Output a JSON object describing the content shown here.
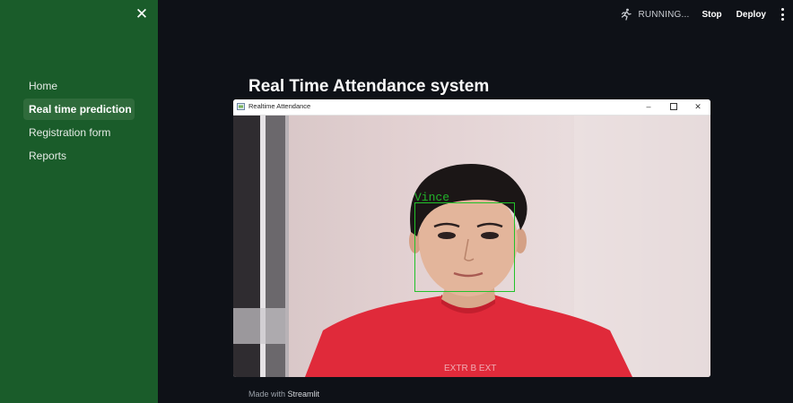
{
  "sidebar": {
    "close_icon": "close-icon",
    "items": [
      {
        "label": "Home",
        "active": false
      },
      {
        "label": "Real time prediction",
        "active": true
      },
      {
        "label": "Registration form",
        "active": false
      },
      {
        "label": "Reports",
        "active": false
      }
    ]
  },
  "header": {
    "status_icon": "running-man-icon",
    "status_text": "RUNNING...",
    "stop_label": "Stop",
    "deploy_label": "Deploy",
    "menu_icon": "kebab-menu-icon"
  },
  "main": {
    "title": "Real Time Attendance system"
  },
  "video_window": {
    "title": "Realtime Attendance",
    "detection_label": "Vince",
    "box_color": "#22c22a"
  },
  "footer": {
    "prefix": "Made with",
    "brand": "Streamlit"
  },
  "colors": {
    "sidebar_bg": "#1a5c2a",
    "active_item_bg": "#2f6b3b",
    "app_bg": "#0e1117"
  }
}
